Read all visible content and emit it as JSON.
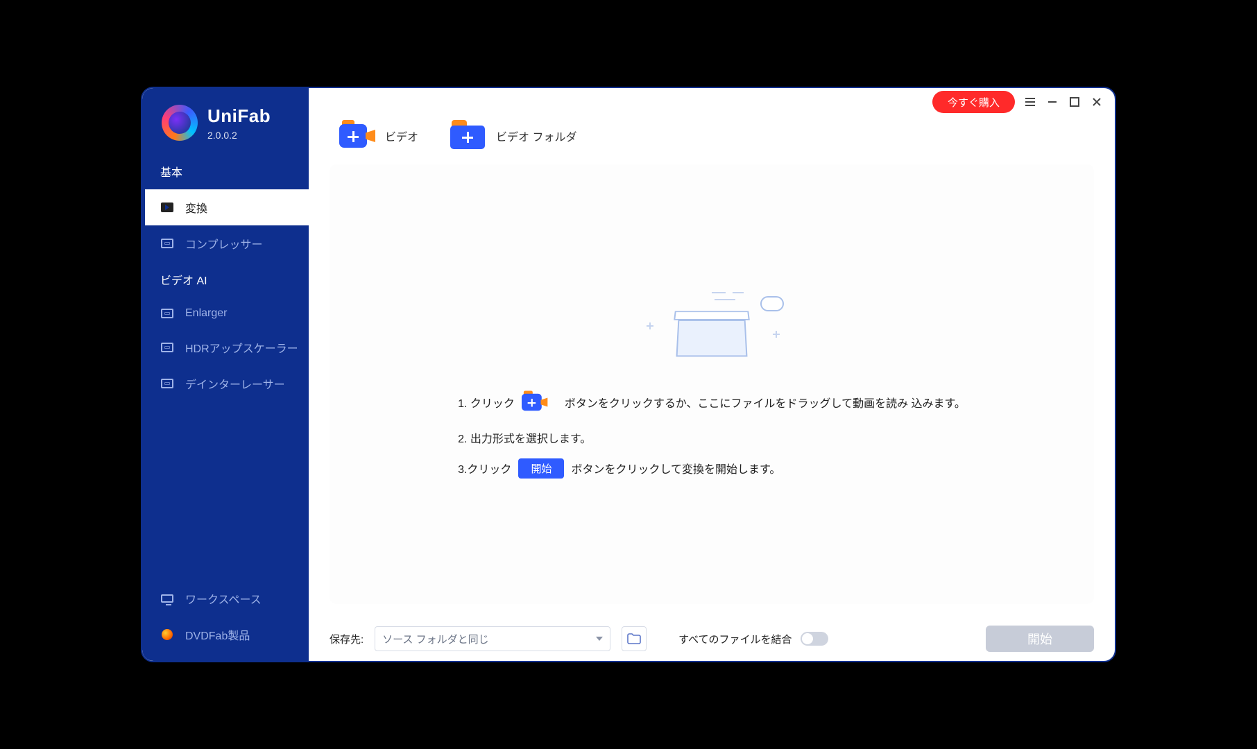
{
  "brand": {
    "name": "UniFab",
    "version": "2.0.0.2"
  },
  "titlebar": {
    "buy_label": "今すぐ購入"
  },
  "sidebar": {
    "section_basic": "基本",
    "section_ai": "ビデオ AI",
    "items": {
      "convert": "変換",
      "compressor": "コンプレッサー",
      "enlarger": "Enlarger",
      "hdr": "HDRアップスケーラー",
      "deint": "デインターレーサー",
      "workspace": "ワークスペース",
      "dvdfab": "DVDFab製品"
    }
  },
  "source": {
    "video": "ビデオ",
    "folder": "ビデオ フォルダ"
  },
  "steps": {
    "s1a": "1. クリック",
    "s1b": "ボタンをクリックするか、ここにファイルをドラッグして動画を読み 込みます。",
    "s2": "2. 出力形式を選択します。",
    "s3a": "3.クリック",
    "s3chip": "開始",
    "s3b": "ボタンをクリックして変換を開始します。"
  },
  "footer": {
    "save_label": "保存先:",
    "save_value": "ソース フォルダと同じ",
    "merge_label": "すべてのファイルを結合",
    "start_label": "開始"
  }
}
